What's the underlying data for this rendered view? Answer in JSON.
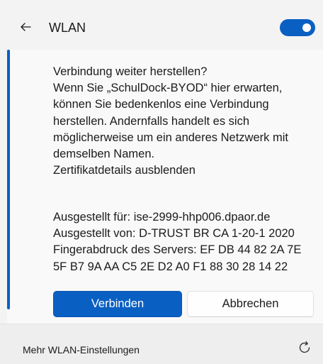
{
  "header": {
    "back_icon": "arrow-left-icon",
    "title": "WLAN",
    "toggle_state": "on",
    "toggle_color": "#0a5fc2"
  },
  "prompt": {
    "lines": [
      "Verbindung weiter herstellen?",
      "Wenn Sie „SchulDock-BYOD“ hier erwarten,",
      "können Sie bedenkenlos eine Verbindung",
      "herstellen. Andernfalls handelt es sich",
      "möglicherweise um ein anderes Netzwerk mit",
      "demselben Namen."
    ],
    "hide_details_link": "Zertifikatdetails ausblenden"
  },
  "certificate": {
    "issued_to": "Ausgestellt für: ise-2999-hhp006.dpaor.de",
    "issued_by": "Ausgestellt von: D-TRUST BR CA 1-20-1 2020",
    "fingerprint_line1": "Fingerabdruck des Servers: EF DB 44 82 2A 7E",
    "fingerprint_line2": "5F B7 9A AA C5 2E D2 A0 F1 88 30 28 14 22"
  },
  "buttons": {
    "connect": "Verbinden",
    "cancel": "Abbrechen",
    "primary_color": "#0a5fc2"
  },
  "footer": {
    "more_settings": "Mehr WLAN-Einstellungen",
    "refresh_icon": "refresh-icon"
  }
}
